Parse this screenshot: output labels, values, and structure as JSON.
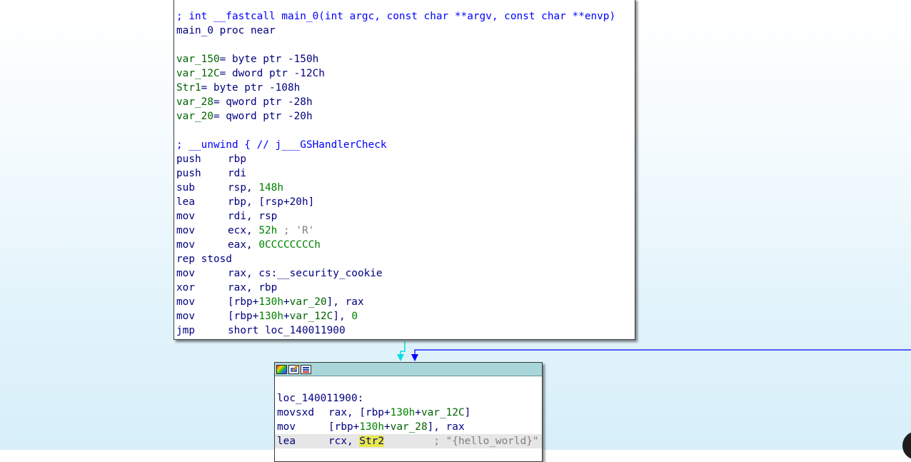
{
  "colors": {
    "keyword": "#000080",
    "comment": "#0000ff",
    "number": "#008000",
    "variable": "#006400",
    "string_comment": "#808080",
    "highlight": "#e8e84a",
    "edge_cyan": "#00e0e0",
    "edge_blue": "#0000ff",
    "node_header": "#a9d6d8"
  },
  "main_block": {
    "comment_signature": "; int __fastcall main_0(int argc, const char **argv, const char **envp)",
    "proc_decl": "main_0 proc near",
    "vars": [
      {
        "name": "var_150",
        "def": "= byte ptr -150h"
      },
      {
        "name": "var_12C",
        "def": "= dword ptr -12Ch"
      },
      {
        "name": "Str1",
        "def": "= byte ptr -108h"
      },
      {
        "name": "var_28",
        "def": "= qword ptr -28h"
      },
      {
        "name": "var_20",
        "def": "= qword ptr -20h"
      }
    ],
    "unwind_comment": "; __unwind { // j___GSHandlerCheck",
    "instructions": [
      {
        "mnemonic": "push",
        "operands": "rbp"
      },
      {
        "mnemonic": "push",
        "operands": "rdi"
      },
      {
        "mnemonic": "sub",
        "op1": "rsp, ",
        "num": "148h"
      },
      {
        "mnemonic": "lea",
        "operands": "rbp, [rsp+20h]"
      },
      {
        "mnemonic": "mov",
        "operands": "rdi, rsp"
      },
      {
        "mnemonic": "mov",
        "op1": "ecx, ",
        "num": "52h",
        "comment": " ; 'R'"
      },
      {
        "mnemonic": "mov",
        "op1": "eax, ",
        "num": "0CCCCCCCCh"
      },
      {
        "mnemonic": "rep stosd",
        "operands": ""
      },
      {
        "mnemonic": "mov",
        "operands": "rax, cs:__security_cookie"
      },
      {
        "mnemonic": "xor",
        "operands": "rax, rbp"
      },
      {
        "mnemonic": "mov",
        "pre": "[rbp+",
        "off": "130h",
        "plus": "+",
        "var": "var_20",
        "post": "], rax"
      },
      {
        "mnemonic": "mov",
        "pre": "[rbp+",
        "off": "130h",
        "plus": "+",
        "var": "var_12C",
        "post": "], ",
        "num": "0"
      },
      {
        "mnemonic": "jmp",
        "operands": "short loc_140011900"
      }
    ]
  },
  "loc_block": {
    "header_icons": [
      "graph-color-icon",
      "edit-node-icon",
      "xref-list-icon"
    ],
    "label": "loc_140011900:",
    "instructions": [
      {
        "mnemonic": "movsxd",
        "pre": "rax, [rbp+",
        "off": "130h",
        "plus": "+",
        "var": "var_12C",
        "post": "]"
      },
      {
        "mnemonic": "mov",
        "pre": "[rbp+",
        "off": "130h",
        "plus": "+",
        "var": "var_28",
        "post": "], rax"
      },
      {
        "mnemonic": "lea",
        "pre": "rcx, ",
        "highlighted": "Str2",
        "comment": "        ; \"{hello_world}\""
      }
    ]
  }
}
